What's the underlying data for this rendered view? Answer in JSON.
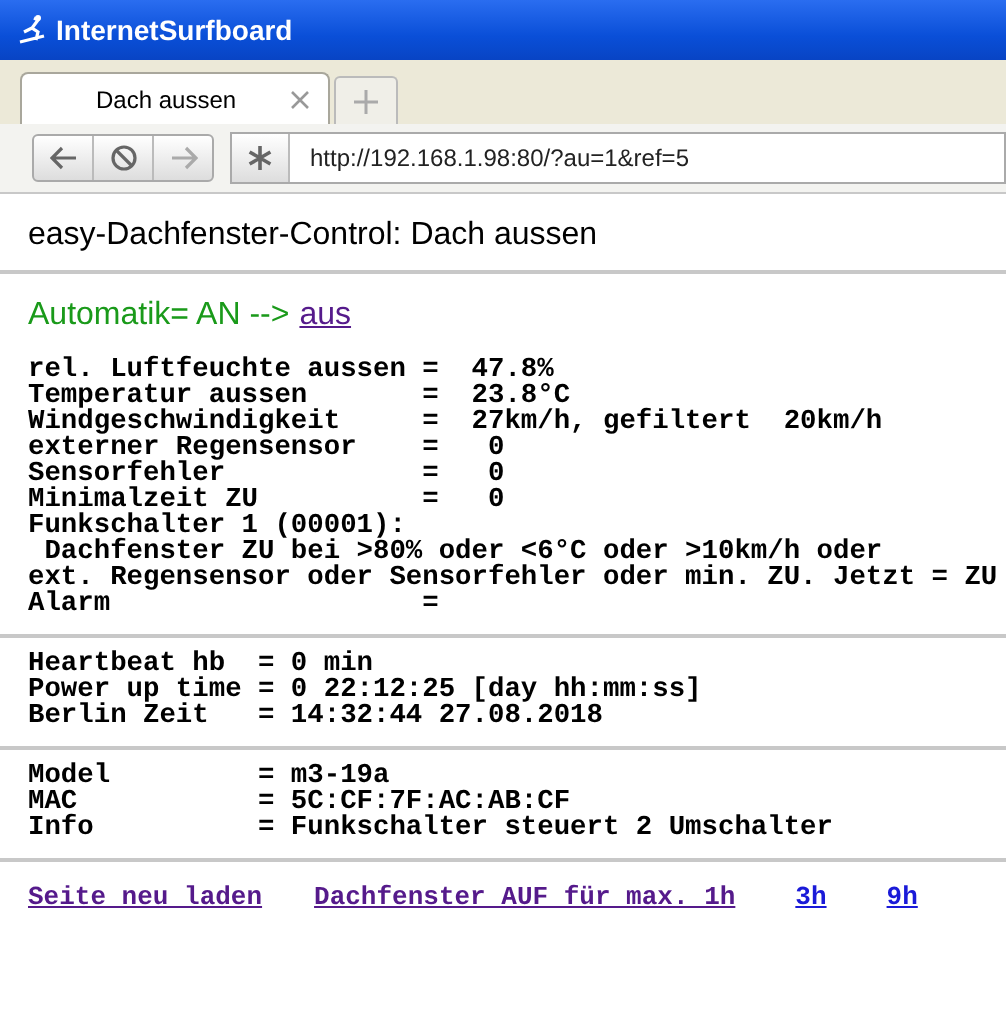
{
  "window": {
    "title": "InternetSurfboard"
  },
  "tabs": [
    {
      "label": "Dach aussen",
      "selected": true
    }
  ],
  "address_bar": {
    "url": "http://192.168.1.98:80/?au=1&ref=5"
  },
  "page": {
    "heading": "easy-Dachfenster-Control: Dach aussen",
    "automatik": {
      "label": "Automatik= AN -->",
      "link": "aus"
    },
    "sections": [
      [
        "rel. Luftfeuchte aussen =  47.8%",
        "Temperatur aussen       =  23.8°C",
        "Windgeschwindigkeit     =  27km/h, gefiltert  20km/h",
        "externer Regensensor    =   0",
        "Sensorfehler            =   0",
        "Minimalzeit ZU          =   0",
        "Funkschalter 1 (00001):",
        " Dachfenster ZU bei >80% oder <6°C oder >10km/h oder",
        "ext. Regensensor oder Sensorfehler oder min. ZU. Jetzt = ZU",
        "Alarm                   ="
      ],
      [
        "Heartbeat hb  = 0 min",
        "Power up time = 0 22:12:25 [day hh:mm:ss]",
        "Berlin Zeit   = 14:32:44 27.08.2018"
      ],
      [
        "Model         = m3-19a",
        "MAC           = 5C:CF:7F:AC:AB:CF",
        "Info          = Funkschalter steuert 2 Umschalter"
      ]
    ],
    "footer_links": [
      "Seite neu laden",
      "Dachfenster AUF für max. 1h",
      "3h",
      "9h"
    ]
  }
}
